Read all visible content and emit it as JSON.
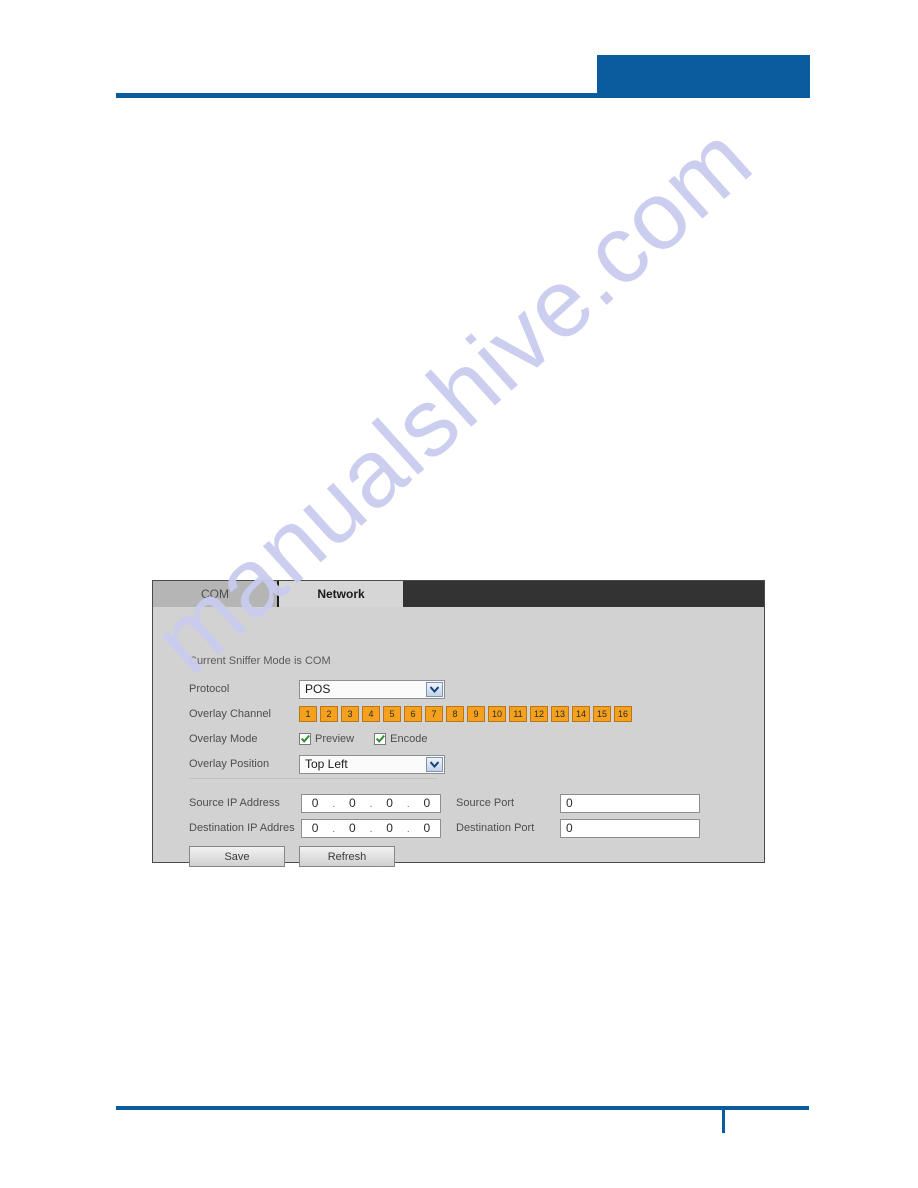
{
  "page": {
    "watermark_text": "manualshive.com",
    "accent_color": "#0a5c9e"
  },
  "panel": {
    "tabs": [
      {
        "label": "COM",
        "active": false
      },
      {
        "label": "Network",
        "active": true
      }
    ],
    "status_text": "Current Sniffer Mode is COM",
    "fields": {
      "protocol": {
        "label": "Protocol",
        "value": "POS"
      },
      "overlay_channel": {
        "label": "Overlay Channel",
        "channels": [
          "1",
          "2",
          "3",
          "4",
          "5",
          "6",
          "7",
          "8",
          "9",
          "10",
          "11",
          "12",
          "13",
          "14",
          "15",
          "16"
        ],
        "channel_color": "#f5a11e"
      },
      "overlay_mode": {
        "label": "Overlay Mode",
        "options": [
          {
            "label": "Preview",
            "checked": true
          },
          {
            "label": "Encode",
            "checked": true
          }
        ]
      },
      "overlay_position": {
        "label": "Overlay Position",
        "value": "Top Left"
      },
      "source_ip": {
        "label": "Source IP Address",
        "octets": [
          "0",
          "0",
          "0",
          "0"
        ]
      },
      "destination_ip": {
        "label": "Destination IP Addres",
        "octets": [
          "0",
          "0",
          "0",
          "0"
        ]
      },
      "source_port": {
        "label": "Source Port",
        "value": "0"
      },
      "destination_port": {
        "label": "Destination Port",
        "value": "0"
      }
    },
    "buttons": {
      "save": "Save",
      "refresh": "Refresh"
    }
  }
}
